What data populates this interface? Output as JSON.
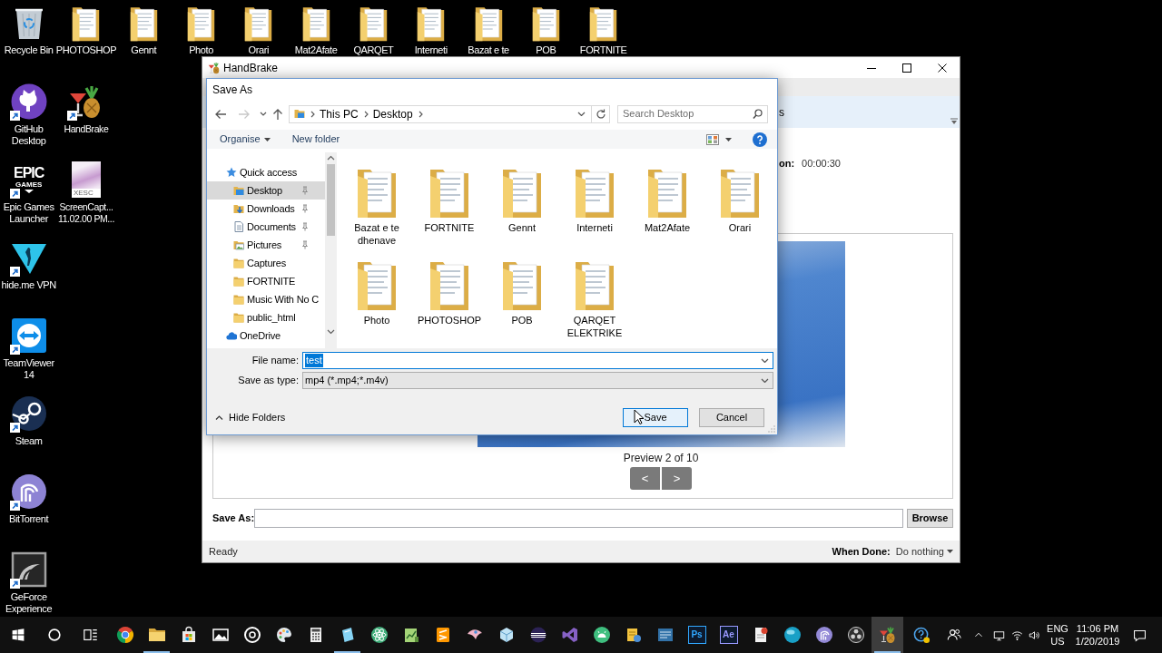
{
  "desktop": {
    "top_row": [
      {
        "label": "Recycle Bin",
        "kind": "bin",
        "shortcut": false
      },
      {
        "label": "PHOTOSHOP",
        "kind": "folder",
        "shortcut": false
      },
      {
        "label": "Gennt",
        "kind": "folder",
        "shortcut": false
      },
      {
        "label": "Photo",
        "kind": "folder",
        "shortcut": false
      },
      {
        "label": "Orari",
        "kind": "folder",
        "shortcut": false
      },
      {
        "label": "Mat2Afate",
        "kind": "folder",
        "shortcut": false
      },
      {
        "label": "QARQET",
        "kind": "folder",
        "shortcut": false
      },
      {
        "label": "Interneti",
        "kind": "folder",
        "shortcut": false
      },
      {
        "label": "Bazat e te",
        "kind": "folder",
        "shortcut": false
      },
      {
        "label": "POB",
        "kind": "folder",
        "shortcut": false
      },
      {
        "label": "FORTNITE",
        "kind": "folder",
        "shortcut": false
      }
    ],
    "column_1": [
      {
        "label": "GitHub Desktop",
        "kind": "cat",
        "shortcut": true
      },
      {
        "label": "Epic Games Launcher",
        "kind": "logo",
        "shortcut": true,
        "logo_text": [
          "EPIC",
          "GAMES"
        ]
      },
      {
        "label": "hide.me VPN",
        "kind": "triangle",
        "shortcut": true
      },
      {
        "label": "TeamViewer 14",
        "kind": "arrows",
        "shortcut": true
      },
      {
        "label": "Steam",
        "kind": "steam",
        "shortcut": true
      },
      {
        "label": "BitTorrent",
        "kind": "torrent",
        "shortcut": true
      },
      {
        "label": "GeForce Experience",
        "kind": "swirl",
        "shortcut": true
      }
    ],
    "column_2": [
      {
        "label": "HandBrake",
        "kind": "fruit",
        "shortcut": true
      },
      {
        "label": "ScreenCapt... 11.02.00 PM...",
        "kind": "file",
        "shortcut": false,
        "badge": "XESC"
      }
    ]
  },
  "handbrake_window": {
    "title": "HandBrake",
    "toolbar_text": "s",
    "duration": {
      "label": "on:",
      "value": "00:00:30"
    },
    "preview": {
      "caption": "Preview 2 of 10",
      "previous": "<",
      "next": ">"
    },
    "destination": {
      "label": "Save As:",
      "button": "Browse"
    },
    "status": "Ready",
    "when_done": {
      "label": "When Done:",
      "value": "Do nothing"
    }
  },
  "save_dialog": {
    "title": "Save As",
    "path": [
      "This PC",
      "Desktop"
    ],
    "search": {
      "placeholder": "Search Desktop"
    },
    "commands": {
      "organise": "Organise",
      "new_folder": "New folder"
    },
    "nav": [
      {
        "label": "Quick access",
        "kind": "star",
        "selected": false,
        "pinned": false
      },
      {
        "label": "Desktop",
        "kind": "desktop",
        "selected": true,
        "pinned": true
      },
      {
        "label": "Downloads",
        "kind": "downloads",
        "selected": false,
        "pinned": true
      },
      {
        "label": "Documents",
        "kind": "documents",
        "selected": false,
        "pinned": true
      },
      {
        "label": "Pictures",
        "kind": "pictures",
        "selected": false,
        "pinned": true
      },
      {
        "label": "Captures",
        "kind": "folder",
        "selected": false,
        "pinned": false
      },
      {
        "label": "FORTNITE",
        "kind": "folder",
        "selected": false,
        "pinned": false
      },
      {
        "label": "Music With No C",
        "kind": "folder",
        "selected": false,
        "pinned": false
      },
      {
        "label": "public_html",
        "kind": "folder",
        "selected": false,
        "pinned": false
      },
      {
        "label": "OneDrive",
        "kind": "cloud",
        "selected": false,
        "pinned": false
      }
    ],
    "files": [
      "Bazat e te dhenave",
      "FORTNITE",
      "Gennt",
      "Interneti",
      "Mat2Afate",
      "Orari",
      "Photo",
      "PHOTOSHOP",
      "POB",
      "QARQET ELEKTRIKE"
    ],
    "file_name": {
      "label": "File name:",
      "value": "test",
      "text_selected": true
    },
    "save_type": {
      "label": "Save as type:",
      "value": "mp4 (*.mp4;*.m4v)"
    },
    "hide_folders": "Hide Folders",
    "buttons": [
      {
        "label": "Save",
        "default": true
      },
      {
        "label": "Cancel",
        "default": false
      }
    ]
  },
  "taskbar": {
    "apps": [
      {
        "kind": "wheel",
        "running": false,
        "selected": false
      },
      {
        "kind": "folder",
        "running": true,
        "selected": false
      },
      {
        "kind": "bag",
        "running": false,
        "selected": false
      },
      {
        "kind": "image",
        "running": false,
        "selected": false
      },
      {
        "kind": "disc",
        "running": false,
        "selected": false
      },
      {
        "kind": "palette",
        "running": false,
        "selected": false
      },
      {
        "kind": "calculator",
        "running": false,
        "selected": false
      },
      {
        "kind": "card",
        "running": true,
        "selected": false
      },
      {
        "kind": "atom",
        "running": false,
        "selected": false
      },
      {
        "kind": "notebook",
        "running": false,
        "selected": false
      },
      {
        "kind": "stripes",
        "running": false,
        "selected": false
      },
      {
        "kind": "bird",
        "running": false,
        "selected": false
      },
      {
        "kind": "cube",
        "running": false,
        "selected": false
      },
      {
        "kind": "eclipse",
        "running": false,
        "selected": false
      },
      {
        "kind": "ribbon",
        "running": false,
        "selected": false
      },
      {
        "kind": "robot",
        "running": false,
        "selected": false
      },
      {
        "kind": "database",
        "running": false,
        "selected": false
      },
      {
        "kind": "grid",
        "running": false,
        "selected": false
      },
      {
        "kind": "tile",
        "glyph": "Ps",
        "color": "#31a8ff",
        "running": false,
        "selected": false
      },
      {
        "kind": "tile",
        "glyph": "Ae",
        "color": "#9999ff",
        "running": false,
        "selected": false
      },
      {
        "kind": "document",
        "running": false,
        "selected": false
      },
      {
        "kind": "sphere",
        "running": false,
        "selected": false
      },
      {
        "kind": "torrent",
        "running": false,
        "selected": false
      },
      {
        "kind": "aperture",
        "running": false,
        "selected": false
      },
      {
        "kind": "pineapple",
        "running": true,
        "selected": true
      }
    ],
    "language": [
      "ENG",
      "US"
    ],
    "clock": {
      "time": "11:06 PM",
      "date": "1/20/2019"
    }
  }
}
